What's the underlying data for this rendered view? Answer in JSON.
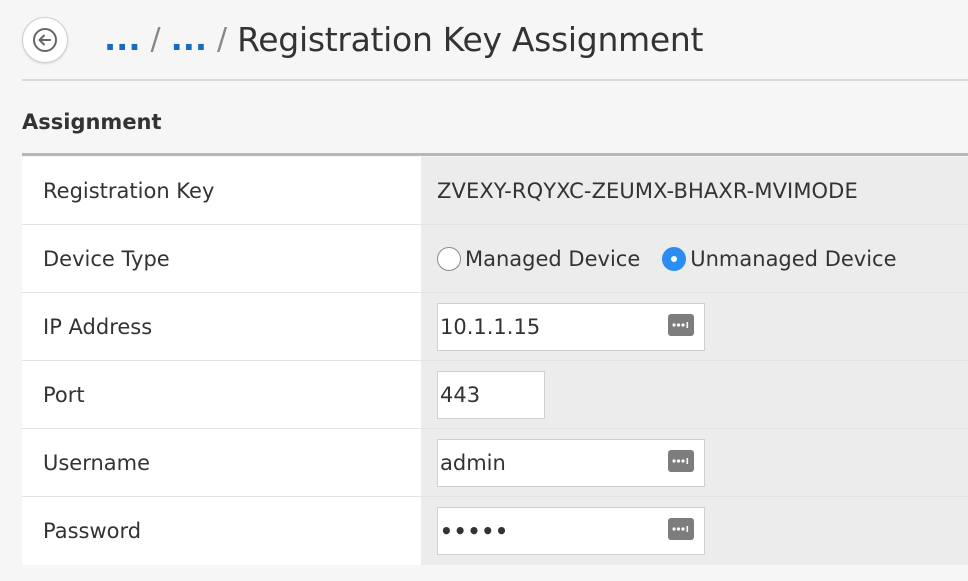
{
  "header": {
    "breadcrumb": [
      {
        "label": "..."
      },
      {
        "label": "..."
      }
    ],
    "separator": "/",
    "title": "Registration Key Assignment"
  },
  "section": {
    "title": "Assignment"
  },
  "form": {
    "registration_key": {
      "label": "Registration Key",
      "value": "ZVEXY-RQYXC-ZEUMX-BHAXR-MVIMODE"
    },
    "device_type": {
      "label": "Device Type",
      "options": [
        {
          "label": "Managed Device",
          "selected": false
        },
        {
          "label": "Unmanaged Device",
          "selected": true
        }
      ]
    },
    "ip_address": {
      "label": "IP Address",
      "value": "10.1.1.15"
    },
    "port": {
      "label": "Port",
      "value": "443"
    },
    "username": {
      "label": "Username",
      "value": "admin"
    },
    "password": {
      "label": "Password",
      "value": "•••••"
    }
  },
  "icons": {
    "back": "arrow-left-icon",
    "field_action": "keychain-icon"
  },
  "colors": {
    "link": "#1a6bbf",
    "radio_selected": "#2b8df0",
    "value_cell_bg": "#ececec",
    "label_cell_bg": "#ffffff"
  }
}
